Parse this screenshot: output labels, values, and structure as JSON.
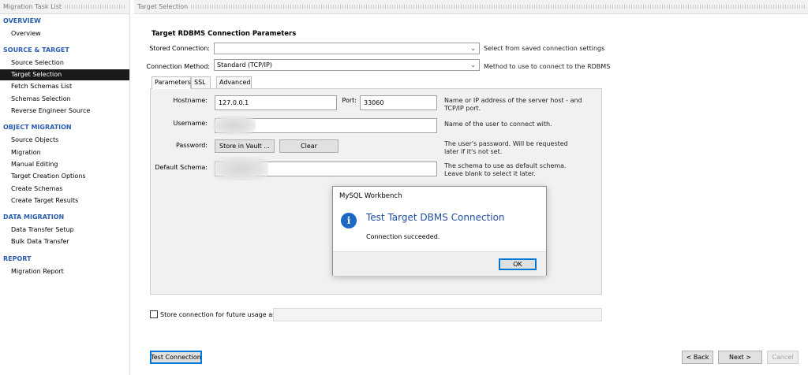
{
  "sidebar": {
    "header": "Migration Task List",
    "sections": [
      {
        "title": "OVERVIEW",
        "items": [
          "Overview"
        ]
      },
      {
        "title": "SOURCE & TARGET",
        "items": [
          "Source Selection",
          "Target Selection",
          "Fetch Schemas List",
          "Schemas Selection",
          "Reverse Engineer Source"
        ]
      },
      {
        "title": "OBJECT MIGRATION",
        "items": [
          "Source Objects",
          "Migration",
          "Manual Editing",
          "Target Creation Options",
          "Create Schemas",
          "Create Target Results"
        ]
      },
      {
        "title": "DATA MIGRATION",
        "items": [
          "Data Transfer Setup",
          "Bulk Data Transfer"
        ]
      },
      {
        "title": "REPORT",
        "items": [
          "Migration Report"
        ]
      }
    ],
    "active_item": "Target Selection"
  },
  "main": {
    "header": "Target Selection",
    "section_title": "Target RDBMS Connection Parameters",
    "stored_connection": {
      "label": "Stored Connection:",
      "value": "",
      "help": "Select from saved connection settings"
    },
    "connection_method": {
      "label": "Connection Method:",
      "value": "Standard (TCP/IP)",
      "help": "Method to use to connect to the RDBMS"
    },
    "tabs": [
      "Parameters",
      "SSL",
      "Advanced"
    ],
    "hostname": {
      "label": "Hostname:",
      "value": "127.0.0.1",
      "help": "Name or IP address of the server host - and TCP/IP port."
    },
    "port": {
      "label": "Port:",
      "value": "33060"
    },
    "username": {
      "label": "Username:",
      "value": "",
      "help": "Name of the user to connect with."
    },
    "password": {
      "label": "Password:",
      "store_button": "Store in Vault ...",
      "clear_button": "Clear",
      "help": "The user's password. Will be requested later if it's not set."
    },
    "default_schema": {
      "label": "Default Schema:",
      "value": "",
      "help": "The schema to use as default schema. Leave blank to select it later."
    },
    "store_connection": {
      "label": "Store connection for future usage as",
      "checked": false,
      "value": ""
    },
    "test_connection_button": "Test Connection",
    "back_button": "< Back",
    "next_button": "Next >",
    "cancel_button": "Cancel"
  },
  "dialog": {
    "title": "MySQL Workbench",
    "icon": "info-icon",
    "heading": "Test Target DBMS Connection",
    "message": "Connection succeeded.",
    "ok_button": "OK"
  },
  "colors": {
    "accent": "#2a5db0",
    "active_nav_bg": "#1a1a1a",
    "dialog_heading": "#1f4fa3",
    "info_icon": "#1c66c4"
  }
}
